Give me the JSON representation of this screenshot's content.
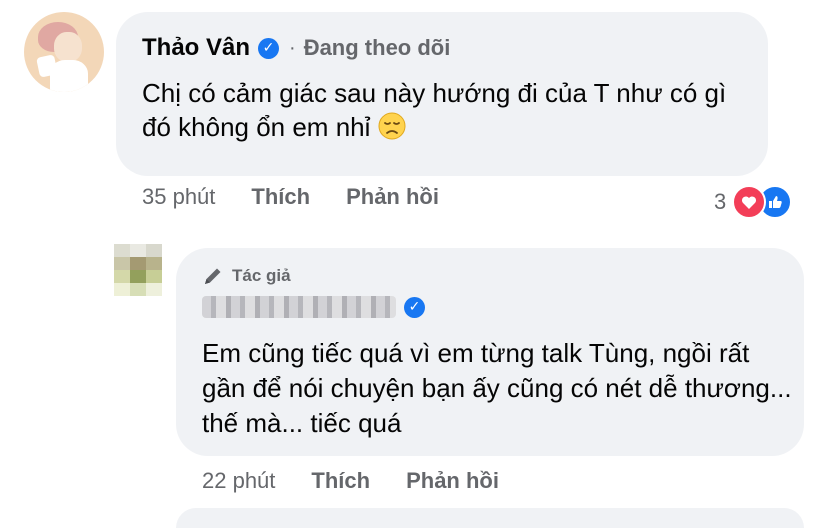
{
  "comment": {
    "author": "Thảo Vân",
    "verified_icon": "verified-badge-icon",
    "separator": "·",
    "status": "Đang theo dõi",
    "text": "Chị có cảm giác sau này hướng đi của T như có gì đó không ổn em nhỉ",
    "emoji_icon": "sad-face-emoji",
    "time": "35 phút",
    "like_label": "Thích",
    "reply_label": "Phản hồi",
    "reaction_count": "3",
    "reaction_icons": [
      "heart-reaction-icon",
      "like-reaction-icon"
    ]
  },
  "reply": {
    "author_badge_icon": "pen-icon",
    "author_badge": "Tác giả",
    "verified_icon": "verified-badge-icon",
    "text": "Em cũng tiếc quá vì em từng talk Tùng, ngồi rất gần để nói chuyện bạn ấy cũng có nét dễ thương... thế mà... tiếc quá",
    "time": "22 phút",
    "like_label": "Thích",
    "reply_label": "Phản hồi"
  },
  "colors": {
    "bubble_bg": "#f0f2f5",
    "meta_text": "#65676b",
    "verified_blue": "#1877f2",
    "heart_red": "#f33e58"
  }
}
